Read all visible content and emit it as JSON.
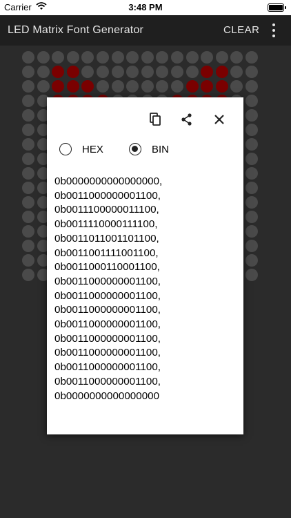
{
  "status_bar": {
    "carrier": "Carrier",
    "time": "3:48 PM"
  },
  "app_bar": {
    "title": "LED Matrix Font Generator",
    "clear_label": "CLEAR"
  },
  "matrix": {
    "columns": 16,
    "rows": 16,
    "on_color": "#7a0000",
    "off_color": "#4a4a4a",
    "visible_rows": 16
  },
  "dialog": {
    "format_options": [
      {
        "label": "HEX",
        "selected": false
      },
      {
        "label": "BIN",
        "selected": true
      }
    ],
    "output_lines": [
      "0b0000000000000000,",
      "0b0011000000001100,",
      "0b0011100000011100,",
      "0b0011110000111100,",
      "0b0011011001101100,",
      "0b0011001111001100,",
      "0b0011000110001100,",
      "0b0011000000001100,",
      "0b0011000000001100,",
      "0b0011000000001100,",
      "0b0011000000001100,",
      "0b0011000000001100,",
      "0b0011000000001100,",
      "0b0011000000001100,",
      "0b0011000000001100,",
      "0b0000000000000000"
    ]
  }
}
